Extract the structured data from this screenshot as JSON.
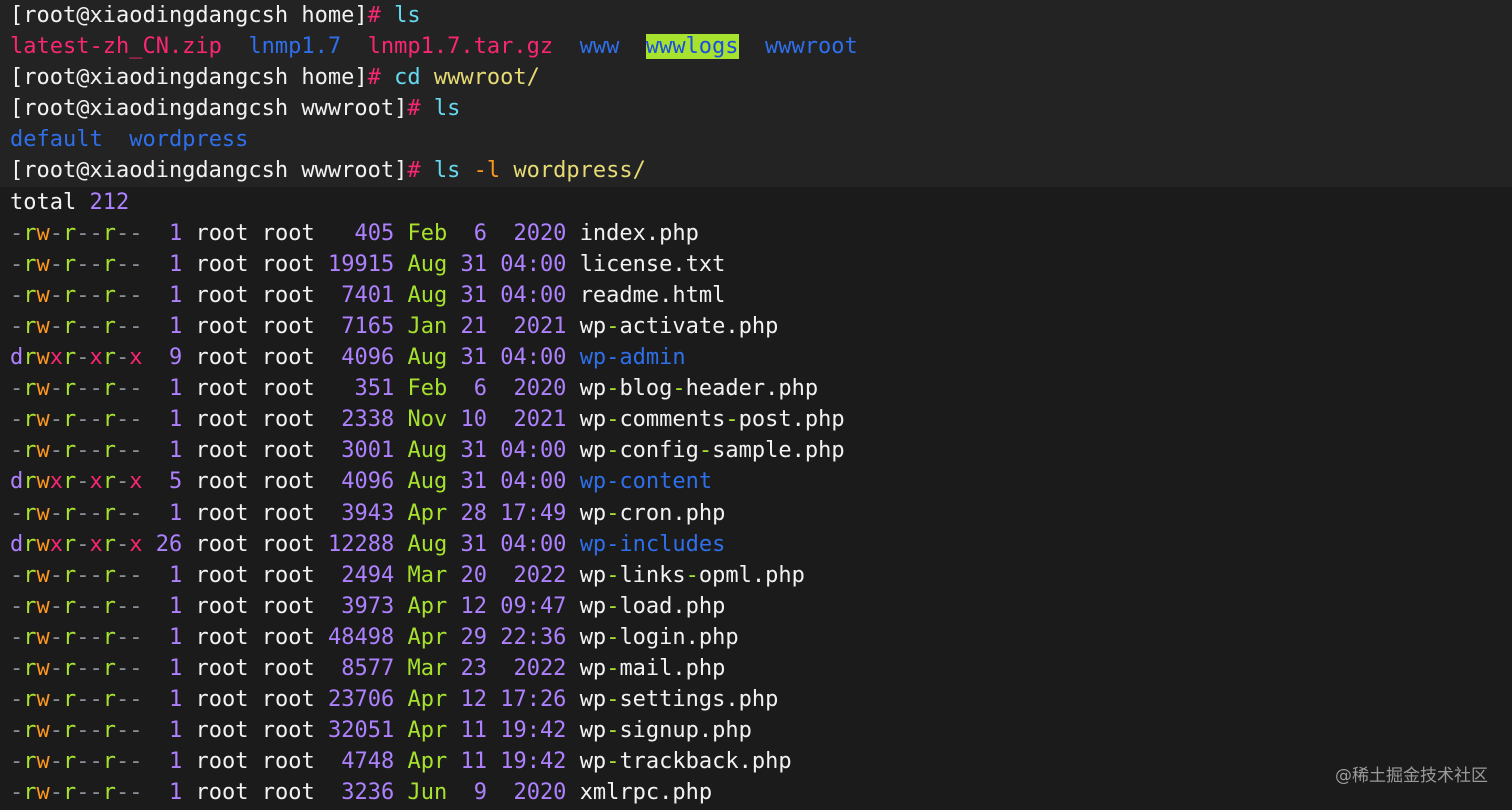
{
  "colors": {
    "text": "#f2f2f2",
    "prompt_hash": "#f92672",
    "command": "#66d9ef",
    "argument": "#e6db74",
    "option": "#fd971f",
    "number": "#ae81ff",
    "date": "#a6e22e",
    "dir": "#2f6fea",
    "archive": "#f92672",
    "perm_r": "#a6e22e",
    "perm_w": "#fd971f",
    "perm_x": "#f92672",
    "perm_d": "#ae81ff",
    "perm_dash": "#8a8f98"
  },
  "terminal": {
    "lines": [
      {
        "band": true,
        "tokens": [
          {
            "t": "[root@xiaodingdangcsh home]",
            "c": "text"
          },
          {
            "t": "# ",
            "c": "prompt_hash"
          },
          {
            "t": "ls",
            "c": "command"
          }
        ]
      },
      {
        "band": true,
        "tokens": [
          {
            "t": "latest-zh_CN.zip",
            "c": "archive"
          },
          {
            "t": "  ",
            "c": "text"
          },
          {
            "t": "lnmp1.7",
            "c": "dir"
          },
          {
            "t": "  ",
            "c": "text"
          },
          {
            "t": "lnmp1.7.tar.gz",
            "c": "archive"
          },
          {
            "t": "  ",
            "c": "text"
          },
          {
            "t": "www",
            "c": "dir"
          },
          {
            "t": "  ",
            "c": "text"
          },
          {
            "t": "wwwlogs",
            "c": "dir",
            "hl": "green"
          },
          {
            "t": "  ",
            "c": "text"
          },
          {
            "t": "wwwroot",
            "c": "dir"
          }
        ]
      },
      {
        "band": true,
        "tokens": [
          {
            "t": "[root@xiaodingdangcsh home]",
            "c": "text"
          },
          {
            "t": "# ",
            "c": "prompt_hash"
          },
          {
            "t": "cd",
            "c": "command"
          },
          {
            "t": " ",
            "c": "text"
          },
          {
            "t": "wwwroot/",
            "c": "argument"
          }
        ]
      },
      {
        "band": true,
        "tokens": [
          {
            "t": "[root@xiaodingdangcsh wwwroot]",
            "c": "text"
          },
          {
            "t": "# ",
            "c": "prompt_hash"
          },
          {
            "t": "ls",
            "c": "command"
          }
        ]
      },
      {
        "band": true,
        "tokens": [
          {
            "t": "default",
            "c": "dir"
          },
          {
            "t": "  ",
            "c": "text"
          },
          {
            "t": "wordpress",
            "c": "dir"
          }
        ]
      },
      {
        "band": true,
        "tokens": [
          {
            "t": "[root@xiaodingdangcsh wwwroot]",
            "c": "text"
          },
          {
            "t": "# ",
            "c": "prompt_hash"
          },
          {
            "t": "ls",
            "c": "command"
          },
          {
            "t": " ",
            "c": "text"
          },
          {
            "t": "-l",
            "c": "option"
          },
          {
            "t": " ",
            "c": "text"
          },
          {
            "t": "wordpress/",
            "c": "argument"
          }
        ]
      },
      {
        "band": false,
        "tokens": [
          {
            "t": "total ",
            "c": "text"
          },
          {
            "t": "212",
            "c": "number"
          }
        ]
      }
    ],
    "listing": [
      {
        "perm": "-rw-r--r--",
        "links": " 1",
        "owner": "root",
        "group": "root",
        "size": "  405",
        "month": "Feb",
        "day": " 6",
        "time": " 2020",
        "name": "index.php",
        "isdir": false
      },
      {
        "perm": "-rw-r--r--",
        "links": " 1",
        "owner": "root",
        "group": "root",
        "size": "19915",
        "month": "Aug",
        "day": "31",
        "time": "04:00",
        "name": "license.txt",
        "isdir": false
      },
      {
        "perm": "-rw-r--r--",
        "links": " 1",
        "owner": "root",
        "group": "root",
        "size": " 7401",
        "month": "Aug",
        "day": "31",
        "time": "04:00",
        "name": "readme.html",
        "isdir": false
      },
      {
        "perm": "-rw-r--r--",
        "links": " 1",
        "owner": "root",
        "group": "root",
        "size": " 7165",
        "month": "Jan",
        "day": "21",
        "time": " 2021",
        "name": "wp-activate.php",
        "isdir": false
      },
      {
        "perm": "drwxr-xr-x",
        "links": " 9",
        "owner": "root",
        "group": "root",
        "size": " 4096",
        "month": "Aug",
        "day": "31",
        "time": "04:00",
        "name": "wp-admin",
        "isdir": true
      },
      {
        "perm": "-rw-r--r--",
        "links": " 1",
        "owner": "root",
        "group": "root",
        "size": "  351",
        "month": "Feb",
        "day": " 6",
        "time": " 2020",
        "name": "wp-blog-header.php",
        "isdir": false
      },
      {
        "perm": "-rw-r--r--",
        "links": " 1",
        "owner": "root",
        "group": "root",
        "size": " 2338",
        "month": "Nov",
        "day": "10",
        "time": " 2021",
        "name": "wp-comments-post.php",
        "isdir": false
      },
      {
        "perm": "-rw-r--r--",
        "links": " 1",
        "owner": "root",
        "group": "root",
        "size": " 3001",
        "month": "Aug",
        "day": "31",
        "time": "04:00",
        "name": "wp-config-sample.php",
        "isdir": false
      },
      {
        "perm": "drwxr-xr-x",
        "links": " 5",
        "owner": "root",
        "group": "root",
        "size": " 4096",
        "month": "Aug",
        "day": "31",
        "time": "04:00",
        "name": "wp-content",
        "isdir": true
      },
      {
        "perm": "-rw-r--r--",
        "links": " 1",
        "owner": "root",
        "group": "root",
        "size": " 3943",
        "month": "Apr",
        "day": "28",
        "time": "17:49",
        "name": "wp-cron.php",
        "isdir": false
      },
      {
        "perm": "drwxr-xr-x",
        "links": "26",
        "owner": "root",
        "group": "root",
        "size": "12288",
        "month": "Aug",
        "day": "31",
        "time": "04:00",
        "name": "wp-includes",
        "isdir": true
      },
      {
        "perm": "-rw-r--r--",
        "links": " 1",
        "owner": "root",
        "group": "root",
        "size": " 2494",
        "month": "Mar",
        "day": "20",
        "time": " 2022",
        "name": "wp-links-opml.php",
        "isdir": false
      },
      {
        "perm": "-rw-r--r--",
        "links": " 1",
        "owner": "root",
        "group": "root",
        "size": " 3973",
        "month": "Apr",
        "day": "12",
        "time": "09:47",
        "name": "wp-load.php",
        "isdir": false
      },
      {
        "perm": "-rw-r--r--",
        "links": " 1",
        "owner": "root",
        "group": "root",
        "size": "48498",
        "month": "Apr",
        "day": "29",
        "time": "22:36",
        "name": "wp-login.php",
        "isdir": false
      },
      {
        "perm": "-rw-r--r--",
        "links": " 1",
        "owner": "root",
        "group": "root",
        "size": " 8577",
        "month": "Mar",
        "day": "23",
        "time": " 2022",
        "name": "wp-mail.php",
        "isdir": false
      },
      {
        "perm": "-rw-r--r--",
        "links": " 1",
        "owner": "root",
        "group": "root",
        "size": "23706",
        "month": "Apr",
        "day": "12",
        "time": "17:26",
        "name": "wp-settings.php",
        "isdir": false
      },
      {
        "perm": "-rw-r--r--",
        "links": " 1",
        "owner": "root",
        "group": "root",
        "size": "32051",
        "month": "Apr",
        "day": "11",
        "time": "19:42",
        "name": "wp-signup.php",
        "isdir": false
      },
      {
        "perm": "-rw-r--r--",
        "links": " 1",
        "owner": "root",
        "group": "root",
        "size": " 4748",
        "month": "Apr",
        "day": "11",
        "time": "19:42",
        "name": "wp-trackback.php",
        "isdir": false
      },
      {
        "perm": "-rw-r--r--",
        "links": " 1",
        "owner": "root",
        "group": "root",
        "size": " 3236",
        "month": "Jun",
        "day": " 9",
        "time": " 2020",
        "name": "xmlrpc.php",
        "isdir": false
      }
    ]
  },
  "watermark": "@稀土掘金技术社区"
}
